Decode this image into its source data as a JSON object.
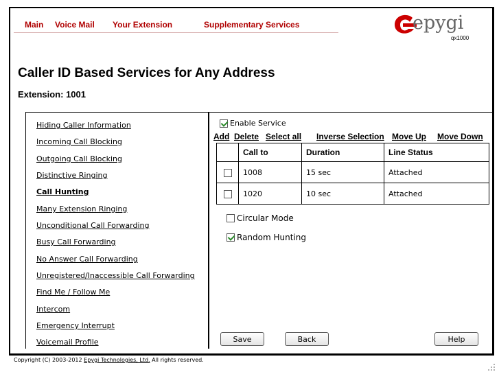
{
  "nav": {
    "items": [
      "Main",
      "Voice Mail",
      "Your Extension",
      "Supplementary Services"
    ]
  },
  "logo": {
    "text": "epygi",
    "model": "qx1000",
    "brand_color": "#cc0000"
  },
  "page": {
    "title": "Caller ID Based Services for Any Address",
    "extension_label": "Extension: 1001"
  },
  "sidebar": {
    "items": [
      "Hiding Caller Information",
      "Incoming Call Blocking",
      "Outgoing Call Blocking",
      "Distinctive Ringing",
      "Call Hunting",
      "Many Extension Ringing",
      "Unconditional Call Forwarding",
      "Busy Call Forwarding",
      "No Answer Call Forwarding",
      "Unregistered/Inaccessible Call Forwarding",
      "Find Me / Follow Me",
      "Intercom",
      "Emergency Interrupt",
      "Voicemail Profile"
    ],
    "active": "Call Hunting"
  },
  "service": {
    "enable_label": "Enable Service",
    "enabled": true,
    "actions": [
      "Add",
      "Delete",
      "Select all",
      "Inverse Selection",
      "Move Up",
      "Move Down"
    ],
    "table": {
      "headers": [
        "Call to",
        "Duration",
        "Line Status"
      ],
      "rows": [
        {
          "call_to": "1008",
          "duration": "15 sec",
          "line_status": "Attached"
        },
        {
          "call_to": "1020",
          "duration": "10 sec",
          "line_status": "Attached"
        }
      ]
    },
    "circular_mode_label": "Circular Mode",
    "circular_mode": false,
    "random_hunting_label": "Random Hunting",
    "random_hunting": true
  },
  "buttons": {
    "save": "Save",
    "back": "Back",
    "help": "Help"
  },
  "footer": {
    "prefix": "Copyright (C) 2003-2012 ",
    "link": "Epygi Technologies, Ltd.",
    "suffix": " All rights reserved."
  }
}
